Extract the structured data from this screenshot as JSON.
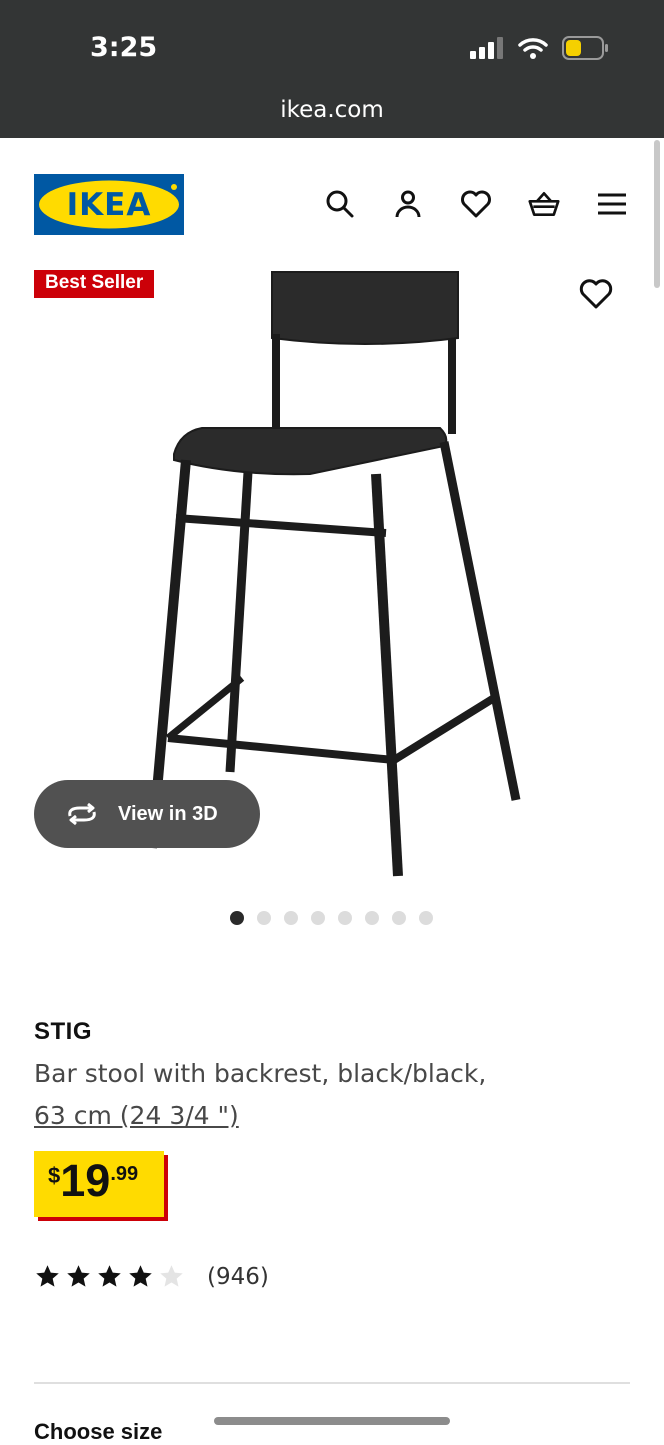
{
  "status": {
    "time": "3:25",
    "url": "ikea.com"
  },
  "header": {
    "logo_text": "IKEA",
    "brand_colors": {
      "blue": "#0058a3",
      "yellow": "#ffdb00"
    }
  },
  "nav": {
    "icons": [
      "search-icon",
      "account-icon",
      "wishlist-icon",
      "cart-icon",
      "menu-icon"
    ]
  },
  "product": {
    "badge": "Best Seller",
    "view3d_label": "View in 3D",
    "carousel": {
      "total": 8,
      "active": 1
    },
    "name": "STIG",
    "description": "Bar stool with backrest, black/black,",
    "size_link": "63 cm (24 3/4 \")",
    "price": {
      "currency": "$",
      "integer": "19",
      "decimals": ".99"
    },
    "rating": {
      "stars": 4,
      "max": 5,
      "count": "(946)"
    }
  },
  "next_section": {
    "title": "Choose size"
  }
}
